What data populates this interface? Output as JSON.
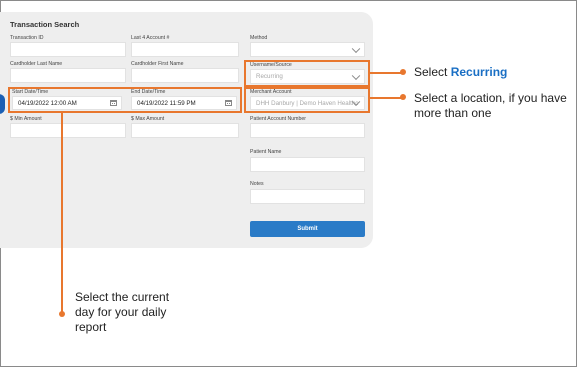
{
  "form": {
    "title": "Transaction Search",
    "transaction_id": {
      "label": "Transaction ID",
      "value": ""
    },
    "last4": {
      "label": "Last 4 Account #",
      "value": ""
    },
    "method": {
      "label": "Method",
      "value": ""
    },
    "cardholder_last": {
      "label": "Cardholder Last Name",
      "value": ""
    },
    "cardholder_first": {
      "label": "Cardholder First Name",
      "value": ""
    },
    "username_source": {
      "label": "Username/Source",
      "value": "Recurring"
    },
    "start_date": {
      "label": "Start Date/Time",
      "value": "04/19/2022 12:00 AM"
    },
    "end_date": {
      "label": "End Date/Time",
      "value": "04/19/2022 11:59 PM"
    },
    "merchant_account": {
      "label": "Merchant Account",
      "value": "DHH Danbury | Demo Haven Healthc"
    },
    "min_amount": {
      "label": "$ Min Amount",
      "value": ""
    },
    "max_amount": {
      "label": "$ Max Amount",
      "value": ""
    },
    "patient_account": {
      "label": "Patient Account Number",
      "value": ""
    },
    "patient_name": {
      "label": "Patient Name",
      "value": ""
    },
    "notes": {
      "label": "Notes",
      "value": ""
    },
    "submit_label": "Submit"
  },
  "callouts": {
    "recurring_prefix": "Select ",
    "recurring_emphasis": "Recurring",
    "location": "Select a location, if you have more than one",
    "day": "Select the current day for your daily report"
  },
  "colors": {
    "highlight": "#e8772e",
    "accent": "#2a7bc7",
    "emphasis": "#1a6fc4"
  },
  "icons": [
    "chevron-down-icon",
    "calendar-icon"
  ]
}
